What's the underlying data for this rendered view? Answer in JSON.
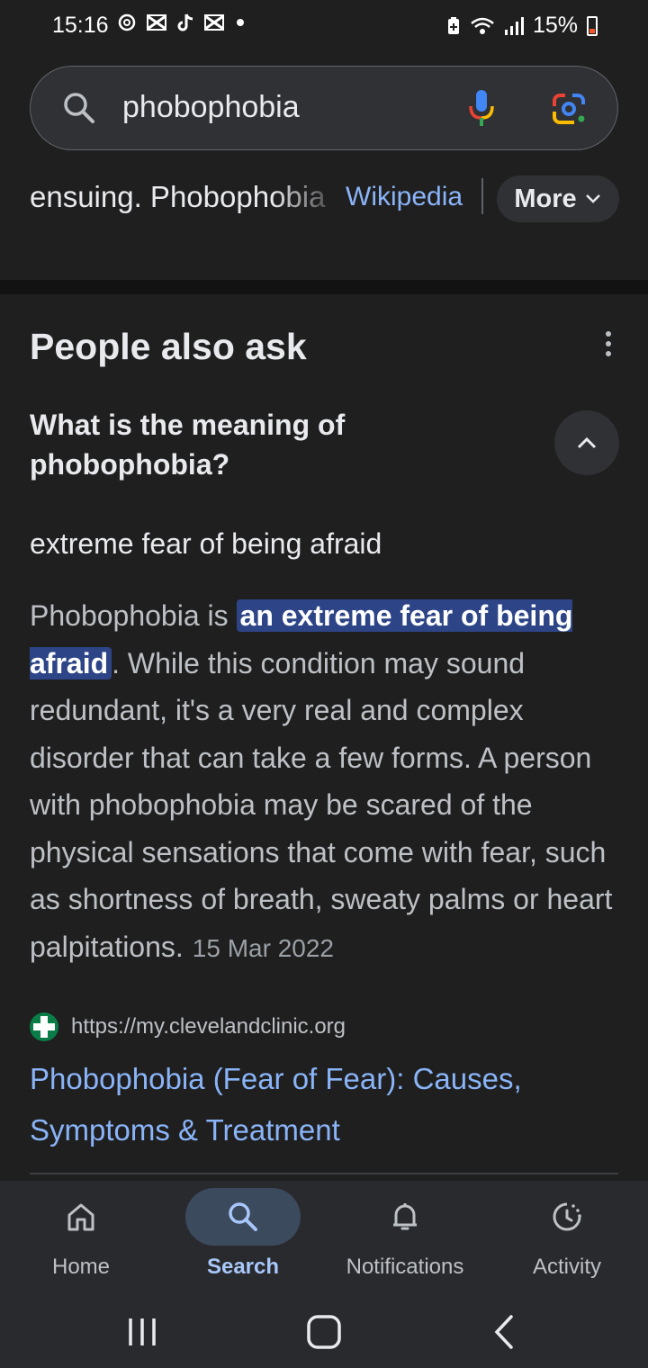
{
  "status_bar": {
    "time": "15:16",
    "notification_icons": [
      "threads-icon",
      "capcut-icon",
      "tiktok-icon",
      "capcut-icon",
      "dot-icon"
    ],
    "battery": "15%",
    "battery_color": "#f5562c"
  },
  "search": {
    "query": "phobophobia"
  },
  "snippet": {
    "text": "ensuing. Phobophobia",
    "source_link": "Wikipedia",
    "more_label": "More"
  },
  "people_also_ask": {
    "title": "People also ask",
    "question": "What is the meaning of phobophobia?",
    "short_answer": "extreme fear of being afraid",
    "answer_prefix": "Phobophobia is ",
    "answer_highlight": "an extreme fear of being afraid",
    "answer_rest": ". While this condition may sound redundant, it's a very real and complex disorder that can take a few forms. A person with phobophobia may be scared of the physical sensations that come with fear, such as shortness of breath, sweaty palms or heart palpitations.",
    "answer_date": "15 Mar 2022",
    "source_url": "https://my.clevelandclinic.org",
    "result_title": "Phobophobia (Fear of Fear): Causes, Symptoms & Treatment"
  },
  "bottom_nav": {
    "items": [
      {
        "label": "Home",
        "icon": "home-icon"
      },
      {
        "label": "Search",
        "icon": "search-icon",
        "active": true
      },
      {
        "label": "Notifications",
        "icon": "bell-icon"
      },
      {
        "label": "Activity",
        "icon": "activity-icon"
      }
    ]
  },
  "colors": {
    "background": "#1f1f1f",
    "link": "#8ab4f8",
    "highlight": "#2d4587",
    "active_nav": "#a8c7fa"
  }
}
